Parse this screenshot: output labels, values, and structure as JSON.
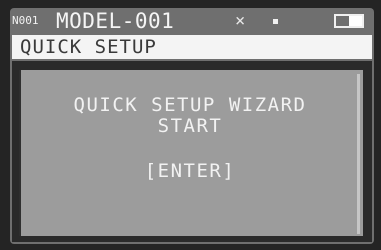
{
  "status": {
    "model_id": "N001",
    "model_name": "MODEL-001",
    "x_symbol": "×",
    "battery_level": 0.5
  },
  "title_bar": {
    "title": "QUICK SETUP"
  },
  "dialog": {
    "line1": "QUICK SETUP WIZARD",
    "line2": "START",
    "enter_label": "[ENTER]"
  }
}
